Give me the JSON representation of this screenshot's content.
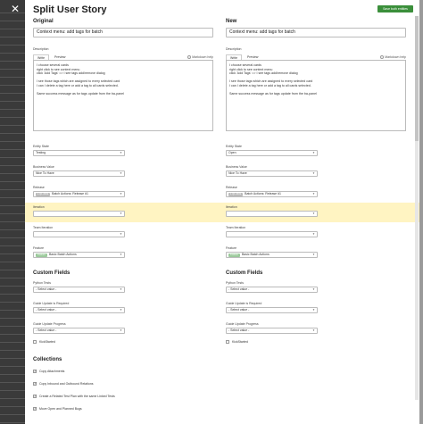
{
  "modal": {
    "title": "Split User Story",
    "save_label": "Save both entities",
    "close_glyph": "✕"
  },
  "original": {
    "heading": "Original",
    "name": "Context menu: add tags for batch",
    "description_label": "Description",
    "tab_write": "Write",
    "tab_preview": "Preview",
    "markdown_help": "Markdown help",
    "description_lines": [
      "I choose several cards",
      "right click to see context menu",
      "click 'Add Tags' => I see tags add/remove dialog",
      "",
      "I see those tags which are assigned to every selected card",
      "I can I delete a tag here or add a tag to all cards selected.",
      "",
      "Same success message as for tags update from the ba-panel"
    ],
    "entity_state_label": "Entity State",
    "entity_state": "Testing",
    "business_value_label": "Business Value",
    "business_value": "Nice To Have",
    "release_label": "Release",
    "release_tag": "1 Q1 2019",
    "release": "Batch Actions: Release #1",
    "iteration_label": "Iteration",
    "iteration": "",
    "team_iteration_label": "Team Iteration",
    "team_iteration": "",
    "feature_label": "Feature",
    "feature_tag": "Feature",
    "feature": "Basic Batch Actions",
    "custom_fields_heading": "Custom Fields",
    "python_tests_label": "Python Tests",
    "python_tests": "- Select value -",
    "guide_update_required_label": "Guide Update is Required",
    "guide_update_required": "- Select value -",
    "guide_update_progress_label": "Guide Update Progress",
    "guide_update_progress": "- Select value -",
    "kickstarted_label": "KickStarted"
  },
  "new": {
    "heading": "New",
    "name": "Context menu: add tags for batch",
    "description_label": "Description",
    "tab_write": "Write",
    "tab_preview": "Preview",
    "markdown_help": "Markdown help",
    "description_lines": [
      "I choose several cards",
      "right click to see context menu",
      "click 'Add Tags' => I see tags add/remove dialog",
      "",
      "I see those tags which are assigned to every selected card",
      "I can I delete a tag here or add a tag to all cards selected.",
      "",
      "Same success message as for tags update from the ba-panel"
    ],
    "entity_state_label": "Entity State",
    "entity_state": "Open",
    "business_value_label": "Business Value",
    "business_value": "Nice To Have",
    "release_label": "Release",
    "release_tag": "1 Q1 2019",
    "release": "Batch Actions: Release #1",
    "iteration_label": "Iteration",
    "iteration": "",
    "team_iteration_label": "Team Iteration",
    "team_iteration": "",
    "feature_label": "Feature",
    "feature_tag": "Feature",
    "feature": "Basic Batch Actions",
    "custom_fields_heading": "Custom Fields",
    "python_tests_label": "Python Tests",
    "python_tests": "- Select value -",
    "guide_update_required_label": "Guide Update is Required",
    "guide_update_required": "- Select value -",
    "guide_update_progress_label": "Guide Update Progress",
    "guide_update_progress": "- Select value -",
    "kickstarted_label": "KickStarted"
  },
  "collections": {
    "heading": "Collections",
    "items": [
      "Copy Attachments",
      "Copy Inbound and Outbound Relations",
      "Create a Related Test Plan with the same Linked Tests",
      "Move Open and Planned Bugs"
    ]
  },
  "colors": {
    "accent_green": "#3b8f3b",
    "highlight": "#fff4c2"
  }
}
